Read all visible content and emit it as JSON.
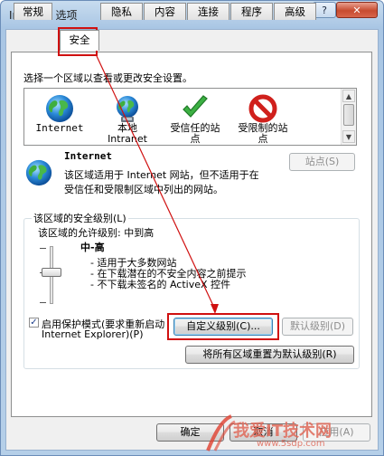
{
  "window": {
    "title": "Internet 选项",
    "help_label": "?",
    "close_label": "✕"
  },
  "tabs": [
    {
      "label": "常规",
      "active": false
    },
    {
      "label": "安全",
      "active": true
    },
    {
      "label": "隐私",
      "active": false
    },
    {
      "label": "内容",
      "active": false
    },
    {
      "label": "连接",
      "active": false
    },
    {
      "label": "程序",
      "active": false
    },
    {
      "label": "高级",
      "active": false
    }
  ],
  "security": {
    "select_zone_prompt": "选择一个区域以查看或更改安全设置。",
    "zones": [
      {
        "name": "Internet",
        "icon": "globe-icon",
        "selected": true
      },
      {
        "name": "本地\nIntranet",
        "icon": "intranet-globe-icon",
        "selected": false
      },
      {
        "name": "受信任的站\n点",
        "icon": "check-icon",
        "selected": false
      },
      {
        "name": "受限制的站\n点",
        "icon": "restricted-icon",
        "selected": false
      }
    ],
    "zone_info": {
      "title": "Internet",
      "description_line1": "该区域适用于 Internet 网站，但不适用于在",
      "description_line2": "受信任和受限制区域中列出的网站。",
      "sites_button": "站点(S)"
    },
    "level": {
      "group_label": "该区域的安全级别(L)",
      "allowed_levels": "该区域的允许级别: 中到高",
      "current_level": "中-高",
      "bullets": [
        "- 适用于大多数网站",
        "- 在下载潜在的不安全内容之前提示",
        "- 不下载未签名的 ActiveX 控件"
      ],
      "slider_fraction": 0.5
    },
    "protected_mode": {
      "label_line1": "启用保护模式(要求重新启动",
      "label_line2": "Internet Explorer)(P)",
      "checked": true,
      "check_glyph": "✓"
    },
    "buttons": {
      "custom_level": "自定义级别(C)...",
      "default_level": "默认级别(D)",
      "reset_all": "将所有区域重置为默认级别(R)"
    }
  },
  "footer": {
    "ok": "确定",
    "cancel": "取消",
    "apply": "应用(A)"
  },
  "watermark": {
    "text": "我爱IT技术网",
    "url": "www.5sdp.com"
  },
  "colors": {
    "annotation_red": "#d01010",
    "title_bar": "#b5cfe8"
  }
}
